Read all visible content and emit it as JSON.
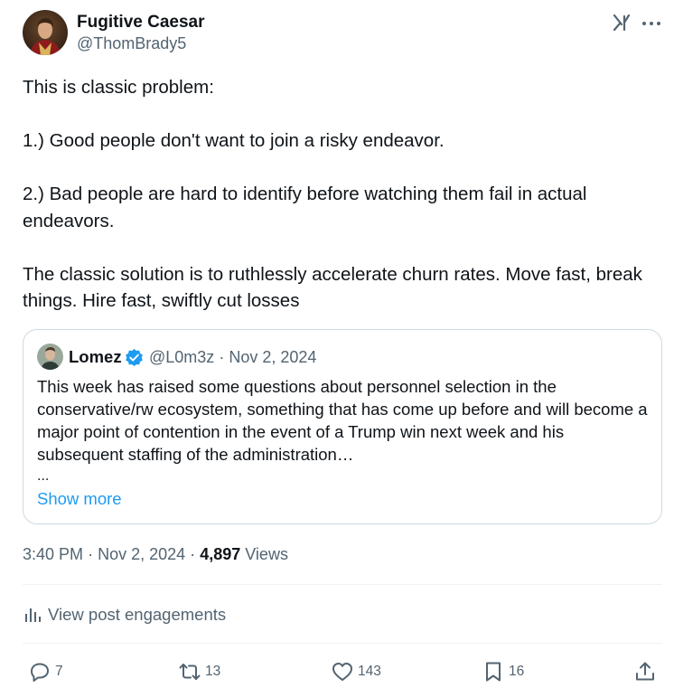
{
  "author": {
    "name": "Fugitive Caesar",
    "handle": "@ThomBrady5"
  },
  "post": {
    "paragraphs": [
      "This is classic problem:",
      "1.) Good people don't want to join a risky endeavor.",
      "2.) Bad people are hard to identify before watching them fail in actual endeavors.",
      "The classic solution is to ruthlessly accelerate churn rates. Move fast, break things. Hire fast, swiftly cut losses"
    ]
  },
  "quote": {
    "name": "Lomez",
    "handle": "@L0m3z",
    "separator": "·",
    "date": "Nov 2, 2024",
    "text": "This week has raised some questions about personnel selection in the conservative/rw ecosystem, something that has come up before and will become a major point of contention in the event of a Trump win next week and his subsequent staffing of the administration…",
    "ellipsis": "...",
    "show_more": "Show more"
  },
  "meta": {
    "time": "3:40 PM",
    "separator": "·",
    "date": "Nov 2, 2024",
    "views_count": "4,897",
    "views_label": "Views"
  },
  "engagements": {
    "label": "View post engagements"
  },
  "actions": {
    "replies": "7",
    "reposts": "13",
    "likes": "143",
    "bookmarks": "16"
  },
  "colors": {
    "text": "#0f1419",
    "secondary": "#536471",
    "link": "#1d9bf0",
    "border": "#cfd9de",
    "verified": "#1d9bf0"
  },
  "icons": [
    "grok-icon",
    "more-icon",
    "verified-icon",
    "analytics-icon",
    "reply-icon",
    "repost-icon",
    "like-icon",
    "bookmark-icon",
    "share-icon"
  ]
}
